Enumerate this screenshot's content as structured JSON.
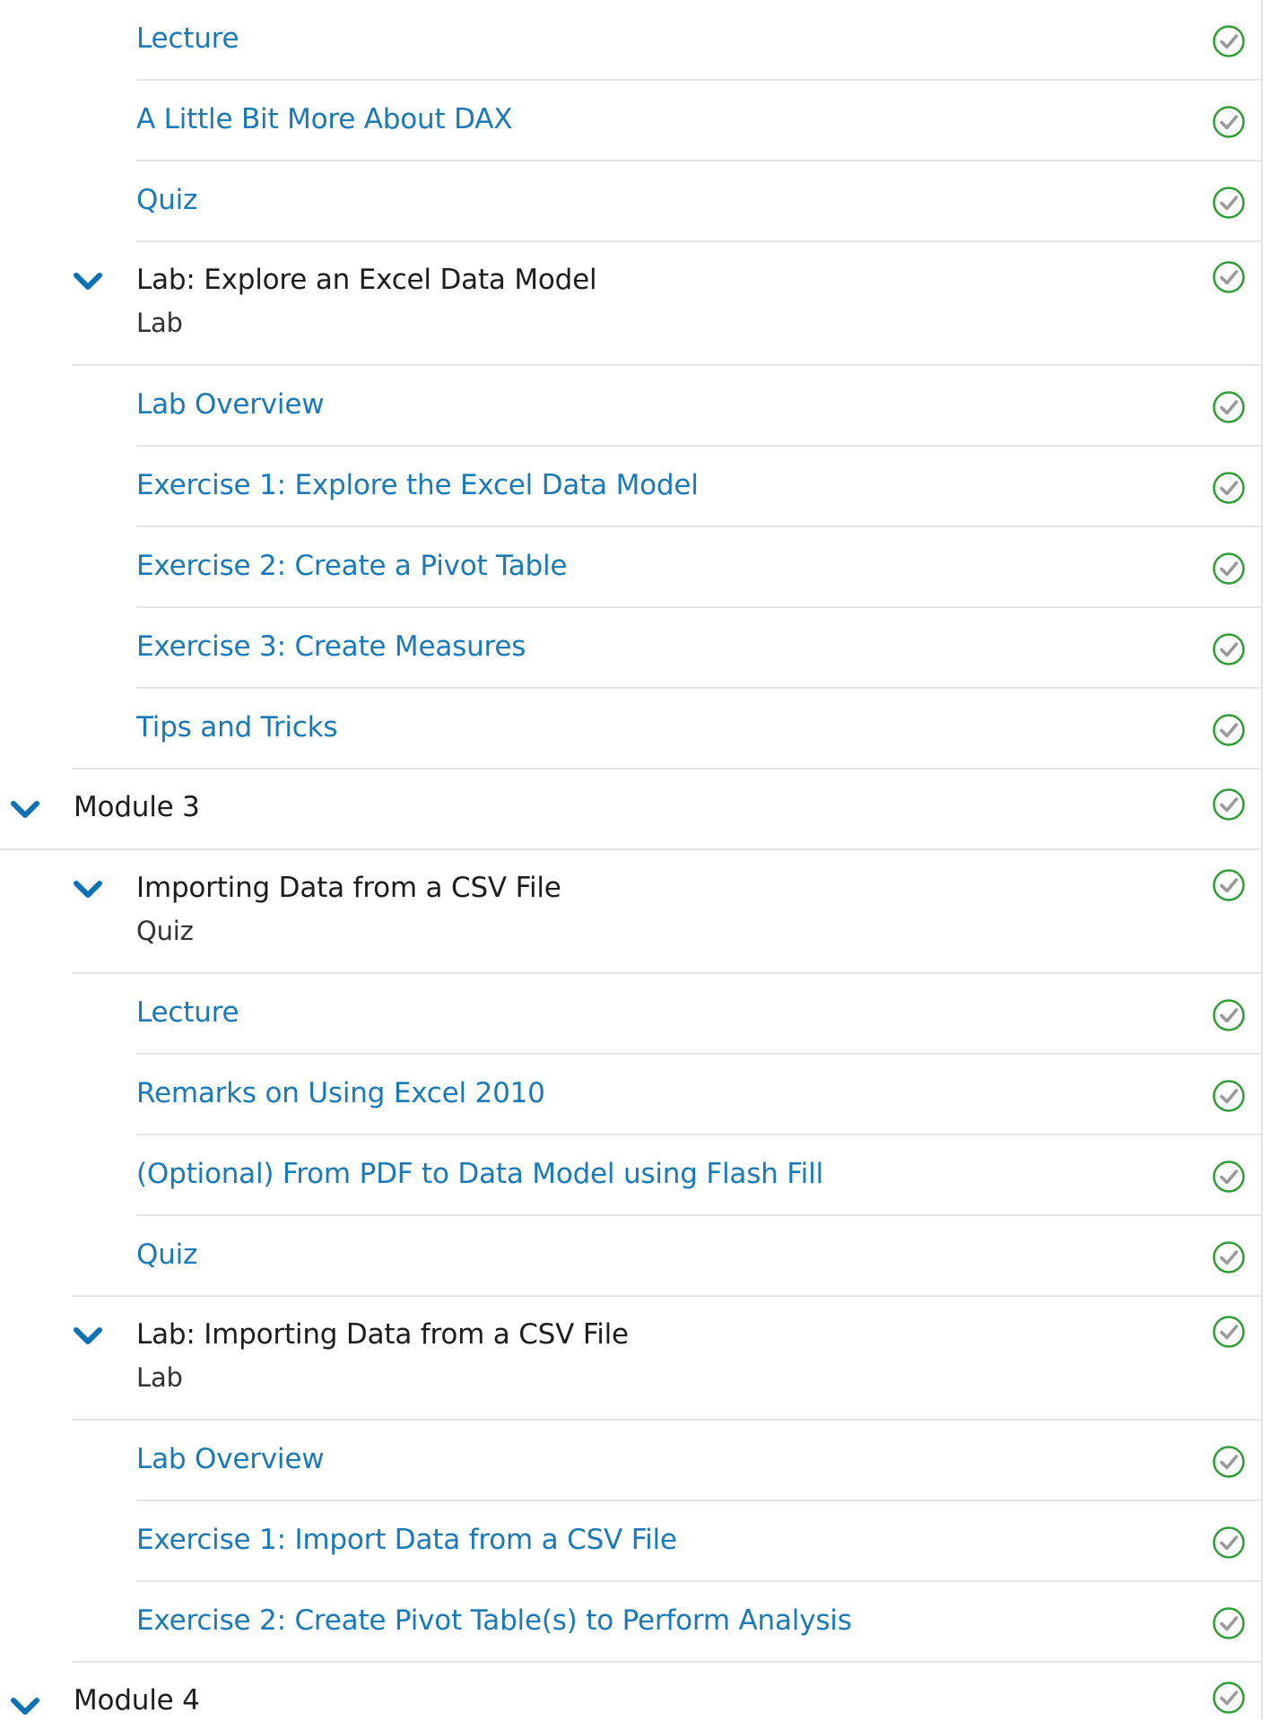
{
  "colors": {
    "link": "#1a7ab8",
    "chevron": "#0b72b5",
    "check_ring": "#2e9e34",
    "check_mark": "#9a9a9a",
    "divider": "#e6e6e6"
  },
  "icons": {
    "expand": "chevron-down-icon",
    "status": "completed-check-icon"
  },
  "group1": {
    "items": [
      {
        "label": "Lecture"
      },
      {
        "label": "A Little Bit More About DAX"
      },
      {
        "label": "Quiz"
      }
    ],
    "lab": {
      "title": "Lab: Explore an Excel Data Model",
      "type": "Lab",
      "items": [
        {
          "label": "Lab Overview"
        },
        {
          "label": "Exercise 1: Explore the Excel Data Model"
        },
        {
          "label": "Exercise 2: Create a Pivot Table"
        },
        {
          "label": "Exercise 3: Create Measures"
        },
        {
          "label": "Tips and Tricks"
        }
      ]
    }
  },
  "module3": {
    "title": "Module 3",
    "section": {
      "title": "Importing Data from a CSV File",
      "type": "Quiz",
      "items": [
        {
          "label": "Lecture"
        },
        {
          "label": "Remarks on Using Excel 2010"
        },
        {
          "label": "(Optional) From PDF to Data Model using Flash Fill"
        },
        {
          "label": "Quiz"
        }
      ]
    },
    "lab": {
      "title": "Lab: Importing Data from a CSV File",
      "type": "Lab",
      "items": [
        {
          "label": "Lab Overview"
        },
        {
          "label": "Exercise 1: Import Data from a CSV File"
        },
        {
          "label": "Exercise 2: Create Pivot Table(s) to Perform Analysis"
        }
      ]
    }
  },
  "module4": {
    "title": "Module 4"
  }
}
